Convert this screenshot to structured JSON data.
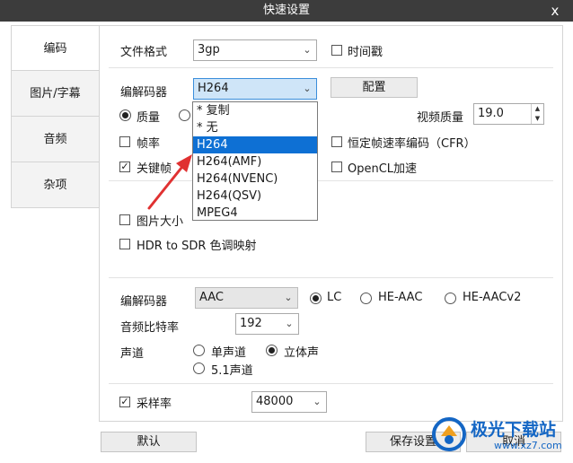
{
  "window": {
    "title": "快速设置",
    "close_glyph": "x"
  },
  "tabs": [
    {
      "label": "编码",
      "active": true
    },
    {
      "label": "图片/字幕"
    },
    {
      "label": "音频"
    },
    {
      "label": "杂项"
    }
  ],
  "video": {
    "format_label": "文件格式",
    "format_value": "3gp",
    "timestamp_label": "时间戳",
    "codec_label": "编解码器",
    "codec_value": "H264",
    "config_button": "配置",
    "quality_label": "质量",
    "video_quality_label": "视频质量",
    "video_quality_value": "19.0",
    "framerate_label": "帧率",
    "cfr_label": "恒定帧速率编码（CFR）",
    "keyframe_label": "关键帧",
    "opencl_label": "OpenCL加速"
  },
  "codec_dropdown": {
    "options": [
      "* 复制",
      "* 无",
      "H264",
      "H264(AMF)",
      "H264(NVENC)",
      "H264(QSV)",
      "MPEG4"
    ],
    "selected_index": 2
  },
  "picture": {
    "image_size_label": "图片大小",
    "hdr_label": "HDR to SDR 色调映射"
  },
  "audio": {
    "codec_label": "编解码器",
    "codec_value": "AAC",
    "profile_options": [
      "LC",
      "HE-AAC",
      "HE-AACv2"
    ],
    "profile_selected": "LC",
    "bitrate_label": "音频比特率",
    "bitrate_value": "192",
    "channels_label": "声道",
    "channel_options": [
      "单声道",
      "立体声",
      "5.1声道"
    ],
    "channel_selected": "立体声",
    "samplerate_label": "采样率",
    "samplerate_value": "48000"
  },
  "footer": {
    "default_button": "默认",
    "save_button": "保存设置",
    "cancel_button": "取消"
  },
  "watermark": {
    "title": "极光下载站",
    "url": "www.xz7.com"
  },
  "colors": {
    "accent": "#0e70d4",
    "annotation_arrow": "#e03131",
    "titlebar": "#3c3c3c"
  },
  "checks": {
    "timestamp": false,
    "framerate": false,
    "cfr": false,
    "keyframe": true,
    "opencl": false,
    "image_size": false,
    "hdr": false,
    "samplerate": true
  },
  "check_glyph": "✓",
  "arrow_glyph": "⌄"
}
